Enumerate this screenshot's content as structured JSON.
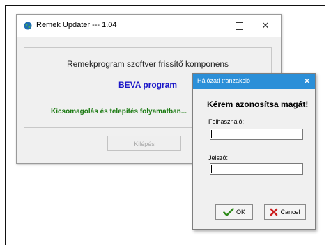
{
  "main_window": {
    "title": "Remek Updater --- 1.04",
    "controls": {
      "minimize": "—",
      "close": "✕"
    },
    "subtitle": "Remekprogram szoftver frissítő komponens",
    "program_name": "BEVA program",
    "status": "Kicsomagolás és telepítés folyamatban...",
    "exit_button_label": "Kilépés"
  },
  "dialog": {
    "title": "Hálózati tranzakció",
    "close_glyph": "✕",
    "prompt": "Kérem azonosítsa magát!",
    "username_label": "Felhasználó:",
    "username_value": "",
    "password_label": "Jelszó:",
    "password_value": "",
    "ok_label": "OK",
    "cancel_label": "Cancel"
  },
  "colors": {
    "dialog_titlebar": "#2b8fd8",
    "program_name": "#1a16c8",
    "status_text": "#1b7a12",
    "ok_check": "#2e8b1a",
    "cancel_x": "#cc1f1f"
  },
  "icons": [
    "app-globe-icon",
    "checkmark-icon",
    "cancel-x-icon"
  ]
}
